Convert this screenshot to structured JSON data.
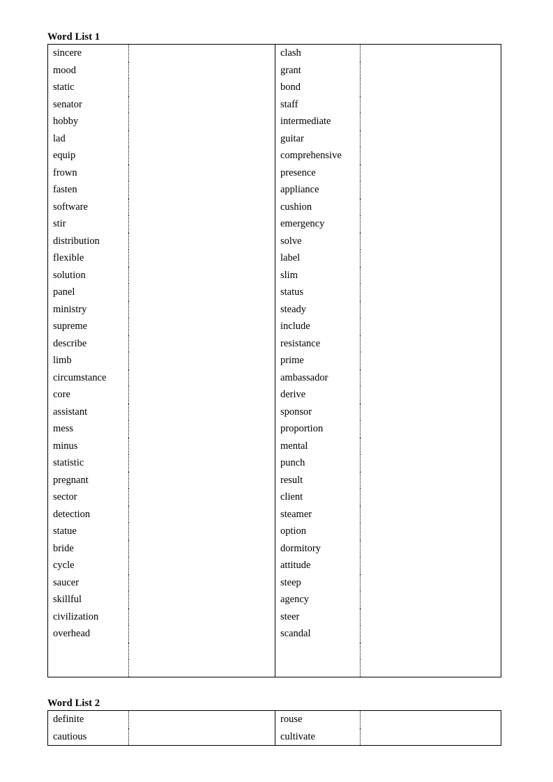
{
  "document": {
    "page_background": "#ffffff",
    "text_color": "#000000"
  },
  "lists": [
    {
      "heading": "Word List 1",
      "columns": [
        {
          "type": "words",
          "words": [
            "sincere",
            "mood",
            "static",
            "senator",
            "hobby",
            "lad",
            "equip",
            "frown",
            "fasten",
            "software",
            "stir",
            "distribution",
            "flexible",
            "solution",
            "panel",
            "ministry",
            "supreme",
            "describe",
            "limb",
            "circumstance",
            "core",
            "assistant",
            "mess",
            "minus",
            "statistic",
            "pregnant",
            "sector",
            "detection",
            "statue",
            "bride",
            "cycle",
            "saucer",
            "skillful",
            "civilization",
            "overhead"
          ]
        },
        {
          "type": "blank",
          "words": []
        },
        {
          "type": "words",
          "words": [
            "clash",
            "grant",
            "bond",
            "staff",
            "intermediate",
            "guitar",
            "comprehensive",
            "presence",
            "appliance",
            "cushion",
            "emergency",
            "solve",
            "label",
            "slim",
            "status",
            "steady",
            "include",
            "resistance",
            "prime",
            "ambassador",
            "derive",
            "sponsor",
            "proportion",
            "mental",
            "punch",
            "result",
            "client",
            "steamer",
            "option",
            "dormitory",
            "attitude",
            "steep",
            "agency",
            "steer",
            "scandal"
          ]
        },
        {
          "type": "blank",
          "words": []
        }
      ],
      "trailing_empty_rows": 2
    },
    {
      "heading": "Word List 2",
      "columns": [
        {
          "type": "words",
          "words": [
            "definite",
            "cautious"
          ]
        },
        {
          "type": "blank",
          "words": []
        },
        {
          "type": "words",
          "words": [
            "rouse",
            "cultivate"
          ]
        },
        {
          "type": "blank",
          "words": []
        }
      ],
      "trailing_empty_rows": 0
    }
  ]
}
